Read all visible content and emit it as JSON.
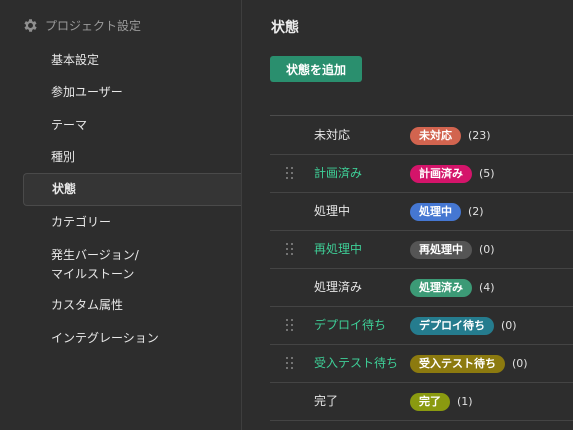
{
  "sidebar": {
    "header": "プロジェクト設定",
    "items": [
      {
        "label": "基本設定",
        "active": false
      },
      {
        "label": "参加ユーザー",
        "active": false
      },
      {
        "label": "テーマ",
        "active": false
      },
      {
        "label": "種別",
        "active": false
      },
      {
        "label": "状態",
        "active": true
      },
      {
        "label": "カテゴリー",
        "active": false
      },
      {
        "label": "発生バージョン/\nマイルストーン",
        "active": false
      },
      {
        "label": "カスタム属性",
        "active": false
      },
      {
        "label": "インテグレーション",
        "active": false
      }
    ]
  },
  "main": {
    "title": "状態",
    "add_button": "状態を追加",
    "statuses": [
      {
        "name": "未対応",
        "badge": "未対応",
        "count": "(23)",
        "color": "#d2644f",
        "custom": false
      },
      {
        "name": "計画済み",
        "badge": "計画済み",
        "count": "(5)",
        "color": "#d4146a",
        "custom": true
      },
      {
        "name": "処理中",
        "badge": "処理中",
        "count": "(2)",
        "color": "#4577d2",
        "custom": false
      },
      {
        "name": "再処理中",
        "badge": "再処理中",
        "count": "(0)",
        "color": "#555555",
        "custom": true
      },
      {
        "name": "処理済み",
        "badge": "処理済み",
        "count": "(4)",
        "color": "#3c9a76",
        "custom": false
      },
      {
        "name": "デプロイ待ち",
        "badge": "デプロイ待ち",
        "count": "(0)",
        "color": "#257c8e",
        "custom": true
      },
      {
        "name": "受入テスト待ち",
        "badge": "受入テスト待ち",
        "count": "(0)",
        "color": "#8c7a0f",
        "custom": true
      },
      {
        "name": "完了",
        "badge": "完了",
        "count": "(1)",
        "color": "#8a9a10",
        "custom": false
      }
    ]
  },
  "colors": {
    "accent": "#2a8f6e",
    "custom_status_text": "#3ecf97",
    "default_status_text": "#e6e6e6"
  },
  "icons": {
    "header": "gear-icon",
    "row_handle": "drag-handle-icon"
  }
}
